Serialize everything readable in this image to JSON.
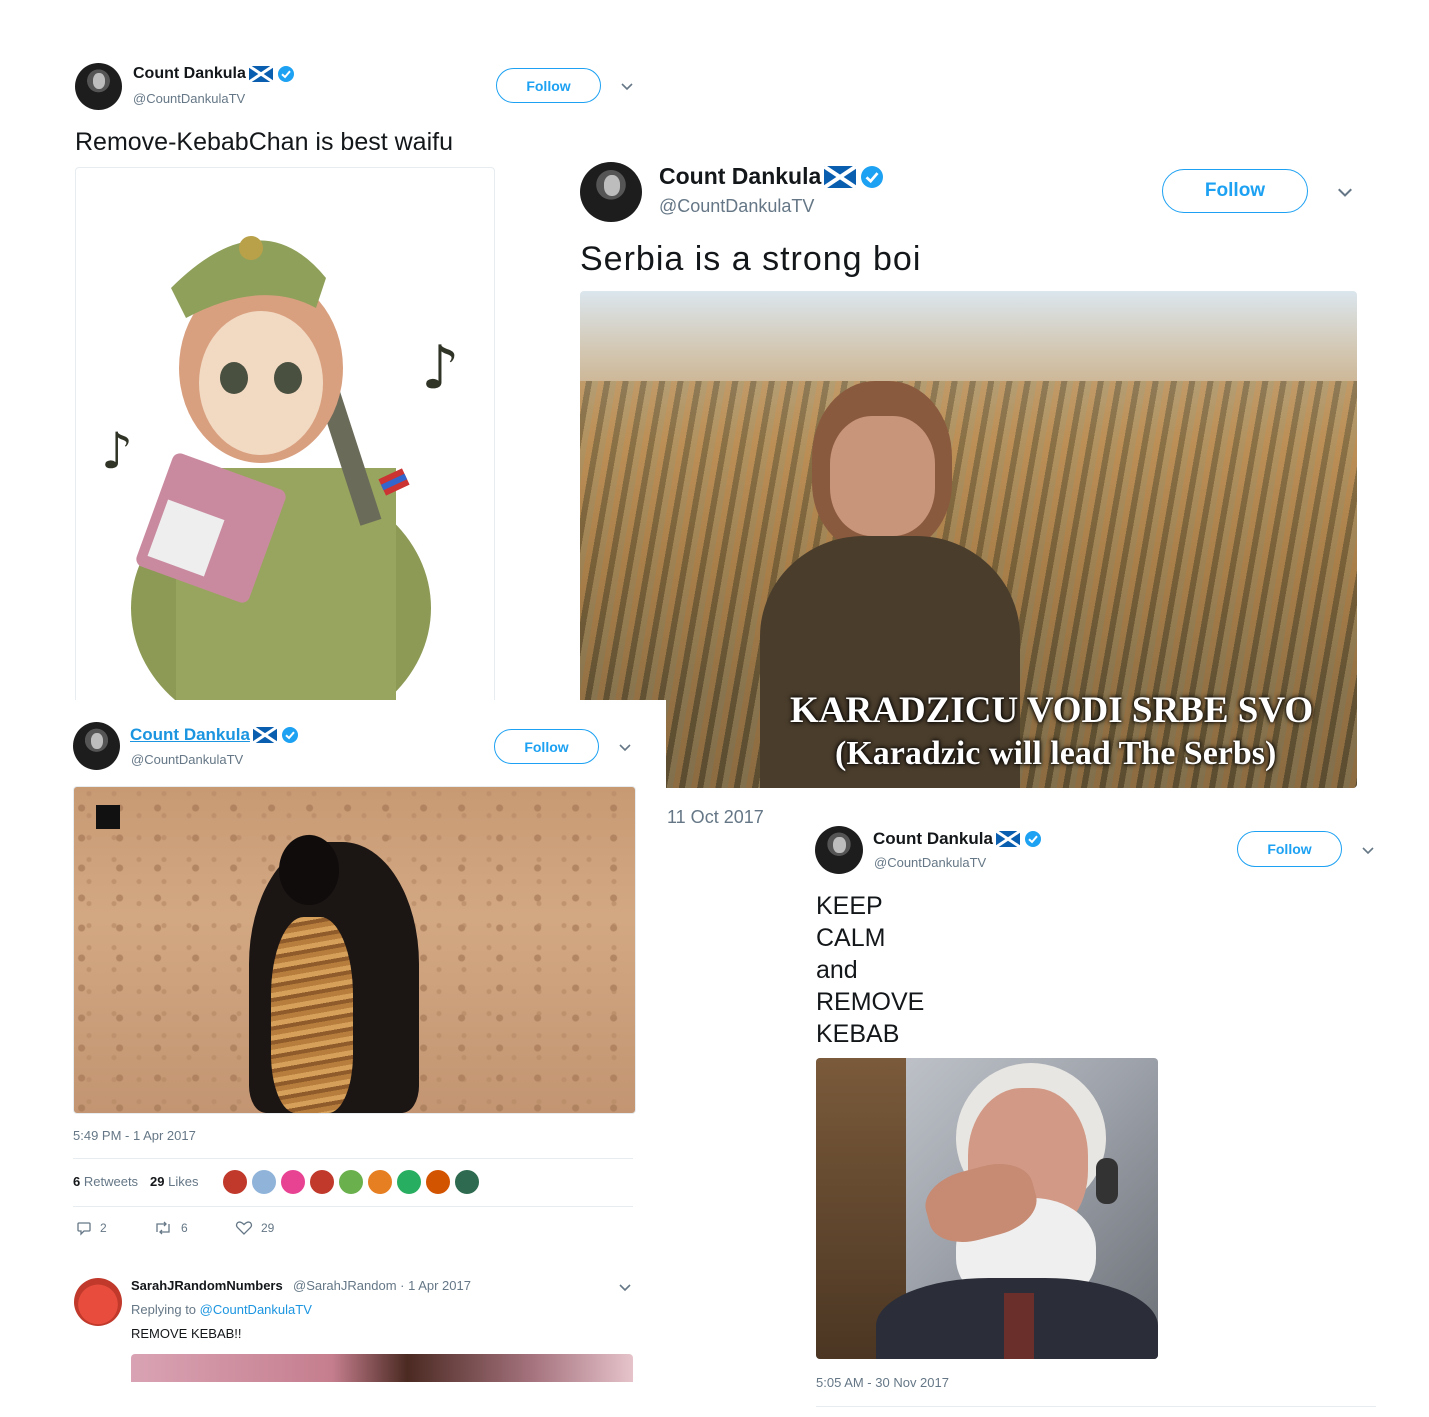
{
  "account": {
    "name": "Count Dankula",
    "handle": "@CountDankulaTV",
    "follow_label": "Follow"
  },
  "tweet1": {
    "text": "Remove-KebabChan is best waifu"
  },
  "tweet2": {
    "text": "Serbia is a strong boi",
    "caption_line1": "KARADZICU VODI SRBE SVO",
    "caption_line2": "(Karadzic will lead The Serbs)",
    "date": "11 Oct 2017"
  },
  "tweet3": {
    "timestamp": "5:49 PM - 1 Apr 2017",
    "retweets_count": "6",
    "retweets_label": "Retweets",
    "likes_count": "29",
    "likes_label": "Likes",
    "reply_count": "2",
    "retweet_count_action": "6",
    "like_count_action": "29"
  },
  "reply": {
    "name": "SarahJRandomNumbers",
    "handle_date": "@SarahJRandom · 1 Apr 2017",
    "replying_to_label": "Replying to",
    "replying_to_handle": "@CountDankulaTV",
    "text": "REMOVE KEBAB!!"
  },
  "tweet4": {
    "line1": "KEEP",
    "line2": "CALM",
    "line3": "and",
    "line4": "REMOVE",
    "line5": "KEBAB",
    "timestamp": "5:05 AM - 30 Nov 2017"
  },
  "colors": {
    "accent": "#1da1f2",
    "secondary_text": "#657786",
    "divider": "#e6ecf0"
  },
  "icons": [
    "verified-badge-icon",
    "scotland-flag-icon",
    "chevron-down-icon",
    "reply-icon",
    "retweet-icon",
    "like-icon"
  ]
}
